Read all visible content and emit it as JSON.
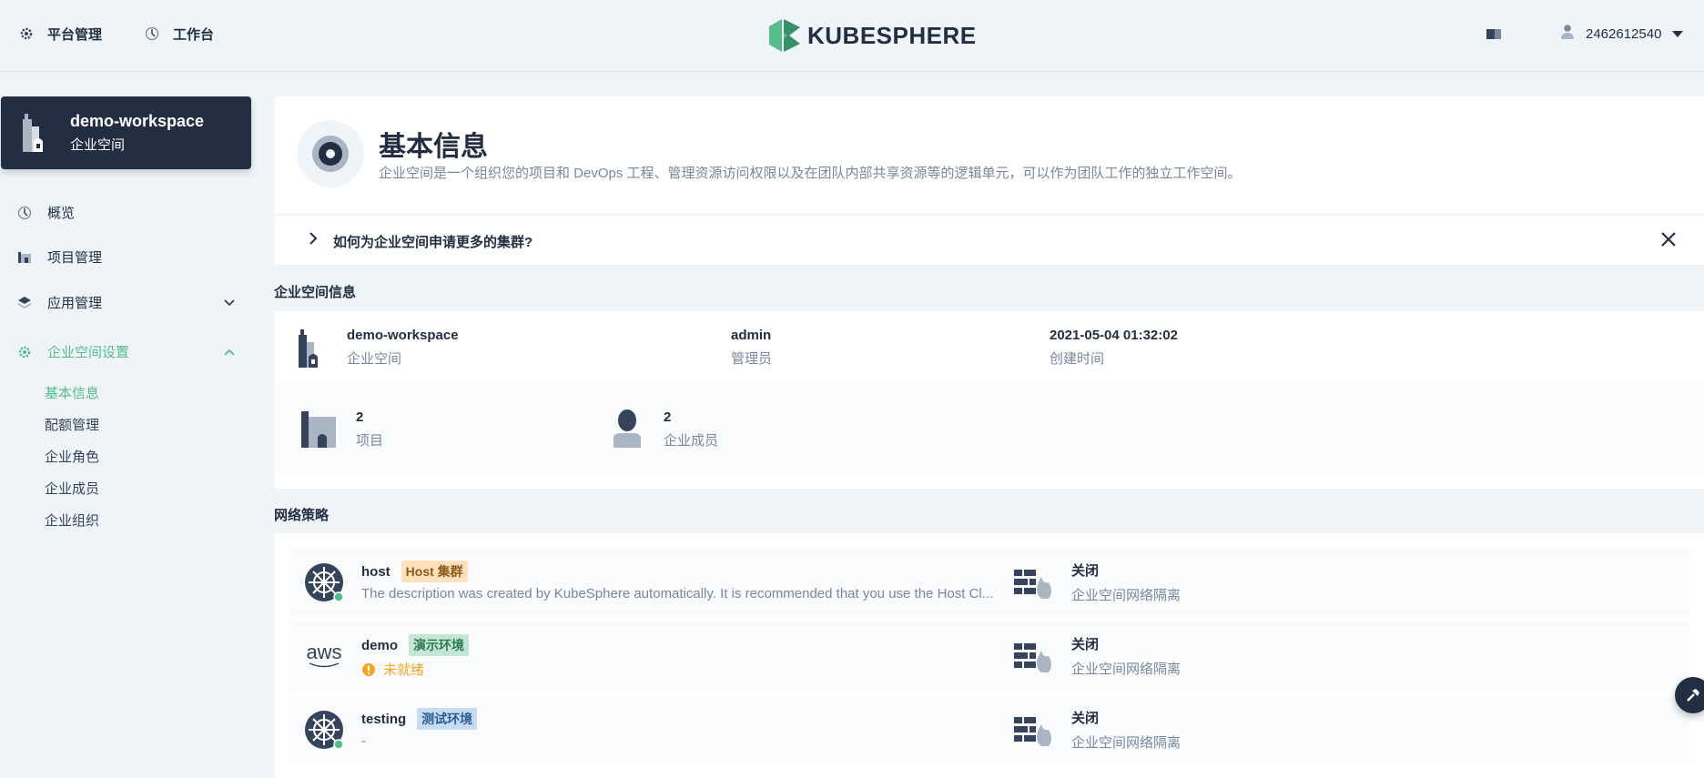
{
  "topbar": {
    "platform_label": "平台管理",
    "workbench_label": "工作台",
    "logo_text": "KUBESPHERE",
    "username": "2462612540"
  },
  "sidebar": {
    "workspace_name": "demo-workspace",
    "workspace_type": "企业空间",
    "items": [
      {
        "label": "概览"
      },
      {
        "label": "项目管理"
      },
      {
        "label": "应用管理"
      },
      {
        "label": "企业空间设置"
      }
    ],
    "sub_items": [
      {
        "label": "基本信息"
      },
      {
        "label": "配额管理"
      },
      {
        "label": "企业角色"
      },
      {
        "label": "企业成员"
      },
      {
        "label": "企业组织"
      }
    ]
  },
  "header": {
    "title": "基本信息",
    "description": "企业空间是一个组织您的项目和 DevOps 工程、管理资源访问权限以及在团队内部共享资源等的逻辑单元，可以作为团队工作的独立工作空间。"
  },
  "tip": {
    "text": "如何为企业空间申请更多的集群?"
  },
  "workspace_info": {
    "section_title": "企业空间信息",
    "name": "demo-workspace",
    "name_label": "企业空间",
    "manager": "admin",
    "manager_label": "管理员",
    "created": "2021-05-04 01:32:02",
    "created_label": "创建时间",
    "projects_count": "2",
    "projects_label": "项目",
    "members_count": "2",
    "members_label": "企业成员"
  },
  "network_policy": {
    "section_title": "网络策略",
    "clusters": [
      {
        "name": "host",
        "tag": "Host 集群",
        "tag_color": "#f5a623",
        "desc": "The description was created by KubeSphere automatically. It is recommended that you use the Host Cl...",
        "state": "关闭",
        "state_label": "企业空间网络隔离"
      },
      {
        "name": "demo",
        "tag": "演示环境",
        "tag_color": "#55bc8a",
        "status": "未就绪",
        "state": "关闭",
        "state_label": "企业空间网络隔离"
      },
      {
        "name": "testing",
        "tag": "测试环境",
        "tag_color": "#3385ff",
        "desc": "-",
        "state": "关闭",
        "state_label": "企业空间网络隔离"
      }
    ]
  },
  "aws_text": "aws"
}
